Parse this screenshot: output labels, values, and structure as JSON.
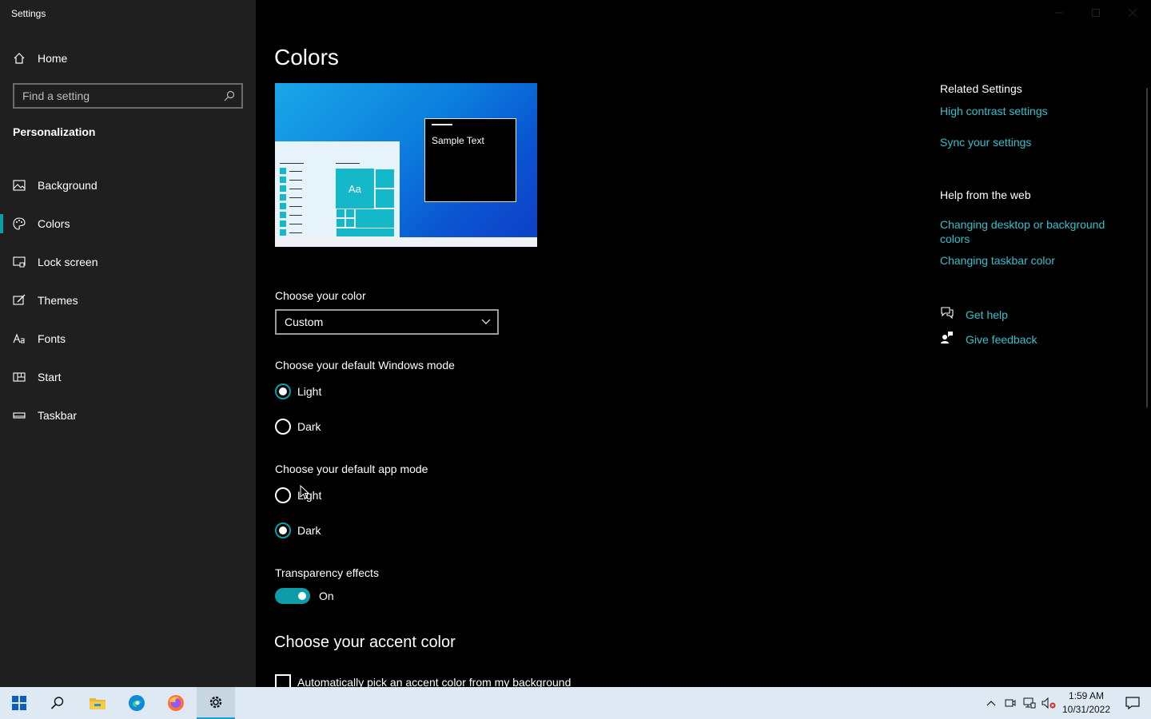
{
  "window": {
    "title": "Settings"
  },
  "sidebar": {
    "home_label": "Home",
    "search_placeholder": "Find a setting",
    "section_title": "Personalization",
    "items": [
      {
        "label": "Background",
        "icon": "image-icon"
      },
      {
        "label": "Colors",
        "icon": "palette-icon",
        "selected": true
      },
      {
        "label": "Lock screen",
        "icon": "lock-screen-icon"
      },
      {
        "label": "Themes",
        "icon": "brush-icon"
      },
      {
        "label": "Fonts",
        "icon": "font-icon"
      },
      {
        "label": "Start",
        "icon": "start-icon"
      },
      {
        "label": "Taskbar",
        "icon": "taskbar-icon"
      }
    ]
  },
  "main": {
    "title": "Colors",
    "preview": {
      "sample_text": "Sample Text",
      "tile_text": "Aa"
    },
    "choose_color": {
      "label": "Choose your color",
      "value": "Custom"
    },
    "windows_mode": {
      "label": "Choose your default Windows mode",
      "options": [
        {
          "label": "Light",
          "selected": true
        },
        {
          "label": "Dark",
          "selected": false
        }
      ]
    },
    "app_mode": {
      "label": "Choose your default app mode",
      "options": [
        {
          "label": "Light",
          "selected": false
        },
        {
          "label": "Dark",
          "selected": true
        }
      ]
    },
    "transparency": {
      "label": "Transparency effects",
      "state": "On"
    },
    "accent": {
      "heading": "Choose your accent color",
      "auto_pick_label": "Automatically pick an accent color from my background"
    }
  },
  "related": {
    "heading": "Related Settings",
    "links": [
      "High contrast settings",
      "Sync your settings"
    ],
    "web_heading": "Help from the web",
    "web_links": [
      "Changing desktop or background colors",
      "Changing taskbar color"
    ],
    "get_help": "Get help",
    "give_feedback": "Give feedback"
  },
  "taskbar": {
    "time": "1:59 AM",
    "date": "10/31/2022",
    "apps": [
      "start-icon",
      "search-icon",
      "file-explorer-icon",
      "edge-icon",
      "firefox-icon",
      "settings-gear-icon"
    ]
  },
  "colors": {
    "accent": "#0e9ca8",
    "link": "#35c0cd",
    "sidebar_bg": "#1f1f1f"
  }
}
